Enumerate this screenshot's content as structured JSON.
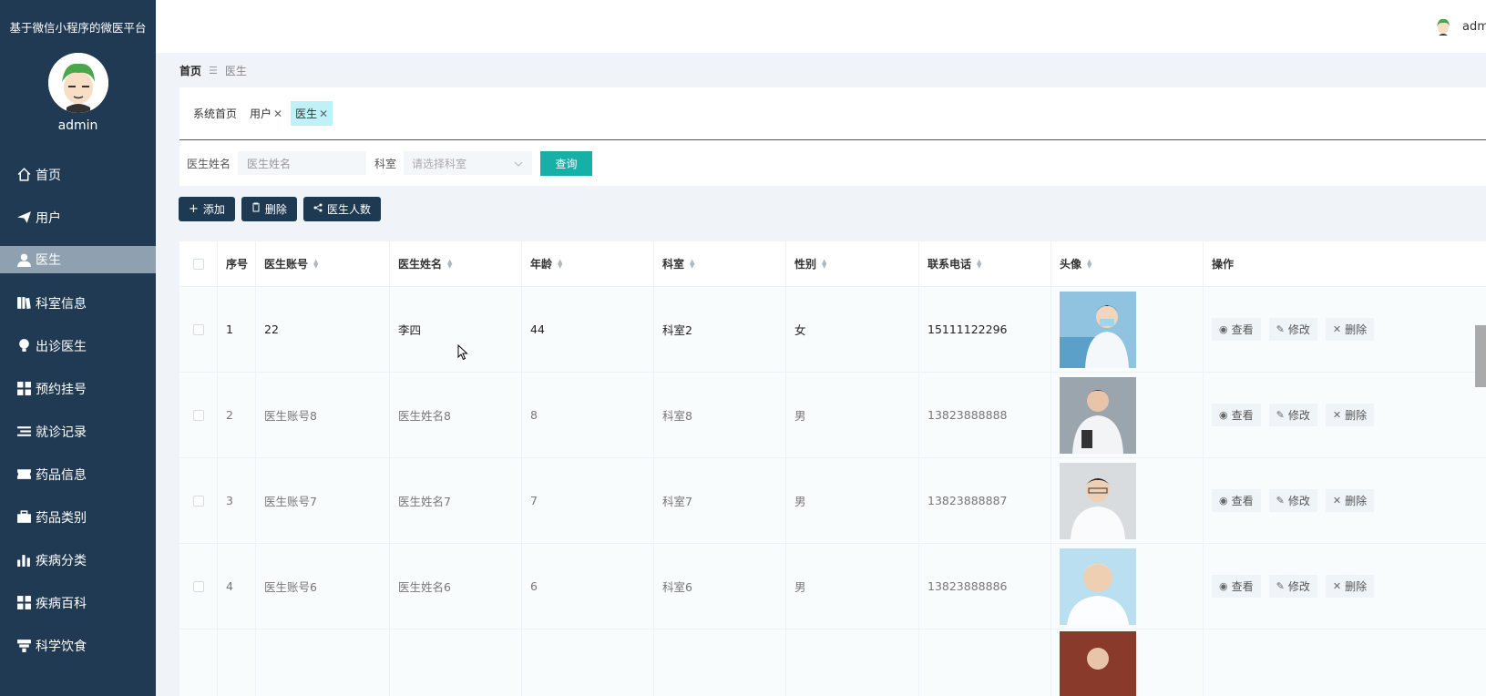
{
  "sidebar": {
    "title": "基于微信小程序的微医平台",
    "username": "admin",
    "items": [
      {
        "label": "首页",
        "icon": "home-icon"
      },
      {
        "label": "用户",
        "icon": "paper-plane-icon"
      },
      {
        "label": "医生",
        "icon": "user-icon"
      },
      {
        "label": "科室信息",
        "icon": "books-icon"
      },
      {
        "label": "出诊医生",
        "icon": "bulb-icon"
      },
      {
        "label": "预约挂号",
        "icon": "grid-icon"
      },
      {
        "label": "就诊记录",
        "icon": "list-icon"
      },
      {
        "label": "药品信息",
        "icon": "ticket-icon"
      },
      {
        "label": "药品类别",
        "icon": "briefcase-icon"
      },
      {
        "label": "疾病分类",
        "icon": "bar-chart-icon"
      },
      {
        "label": "疾病百科",
        "icon": "grid-icon"
      },
      {
        "label": "科学饮食",
        "icon": "totem-icon"
      }
    ],
    "active_index": 2
  },
  "topbar": {
    "username": "admin"
  },
  "breadcrumb": {
    "home": "首页",
    "separator": "☰",
    "current": "医生"
  },
  "tabs": [
    {
      "label": "系统首页",
      "closable": false
    },
    {
      "label": "用户",
      "closable": true
    },
    {
      "label": "医生",
      "closable": true
    }
  ],
  "filters": {
    "name_label": "医生姓名",
    "name_placeholder": "医生姓名",
    "dept_label": "科室",
    "dept_placeholder": "请选择科室",
    "query_label": "查询"
  },
  "actions": {
    "add": "添加",
    "delete": "删除",
    "count": "医生人数"
  },
  "table": {
    "headers": [
      "序号",
      "医生账号",
      "医生姓名",
      "年龄",
      "科室",
      "性别",
      "联系电话",
      "头像",
      "操作"
    ],
    "rows": [
      {
        "index": "1",
        "account": "22",
        "name": "李四",
        "age": "44",
        "dept": "科室2",
        "gender": "女",
        "phone": "15111122296"
      },
      {
        "index": "2",
        "account": "医生账号8",
        "name": "医生姓名8",
        "age": "8",
        "dept": "科室8",
        "gender": "男",
        "phone": "13823888888"
      },
      {
        "index": "3",
        "account": "医生账号7",
        "name": "医生姓名7",
        "age": "7",
        "dept": "科室7",
        "gender": "男",
        "phone": "13823888887"
      },
      {
        "index": "4",
        "account": "医生账号6",
        "name": "医生姓名6",
        "age": "6",
        "dept": "科室6",
        "gender": "男",
        "phone": "13823888886"
      }
    ],
    "ops": {
      "view": "查看",
      "edit": "修改",
      "delete": "删除"
    }
  },
  "colors": {
    "sidebar": "#1f3a52",
    "accent": "#17b0a7",
    "active_tab": "#bff1f8"
  }
}
